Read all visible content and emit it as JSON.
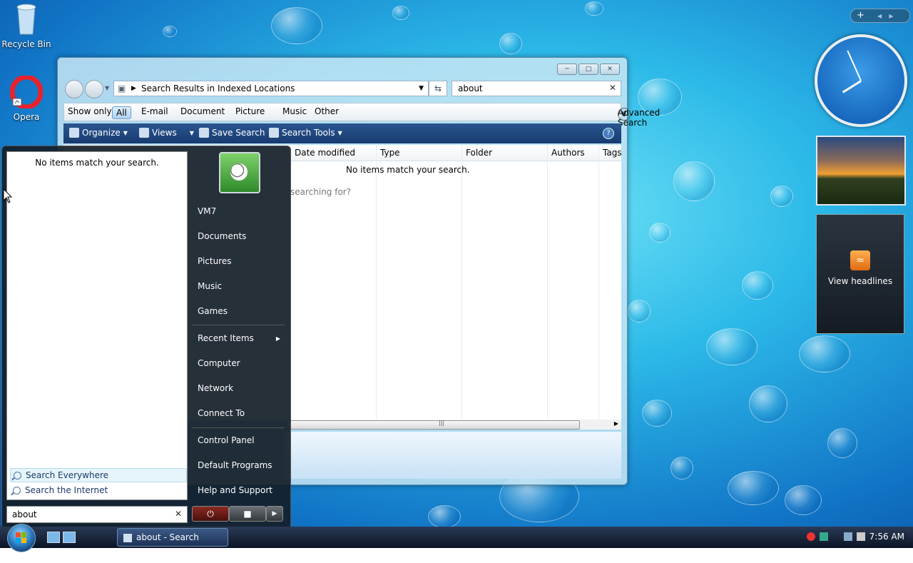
{
  "desktop": {
    "icons": [
      {
        "label": "Recycle Bin",
        "icon": "recycle-bin-icon"
      },
      {
        "label": "Opera",
        "icon": "opera-icon"
      }
    ]
  },
  "explorer": {
    "address": "Search Results in Indexed Locations",
    "search_value": "about",
    "filter_label": "Show only:",
    "filters": [
      "All",
      "E-mail",
      "Document",
      "Picture",
      "Music",
      "Other"
    ],
    "active_filter": "All",
    "advanced_search": "Advanced Search",
    "toolbar": {
      "organize": "Organize",
      "views": "Views",
      "save_search": "Save Search",
      "search_tools": "Search Tools"
    },
    "columns": [
      "Date modified",
      "Type",
      "Folder",
      "Authors",
      "Tags"
    ],
    "empty_message": "No items match your search.",
    "partial_hint": "searching for?"
  },
  "start_menu": {
    "results_message": "No items match your search.",
    "search_links": [
      "Search Everywhere",
      "Search the Internet"
    ],
    "search_value": "about",
    "right_items": [
      "VM7",
      "Documents",
      "Pictures",
      "Music",
      "Games",
      "Recent Items",
      "Computer",
      "Network",
      "Connect To",
      "Control Panel",
      "Default Programs",
      "Help and Support"
    ]
  },
  "gadgets": {
    "feed_label": "View headlines",
    "clock_time": {
      "hour": 7,
      "minute": 56
    }
  },
  "taskbar": {
    "task_label": "about - Search Resu...",
    "clock": "7:56 AM"
  },
  "colors": {
    "accent": "#2a5590",
    "highlight": "#e6f4fb"
  }
}
